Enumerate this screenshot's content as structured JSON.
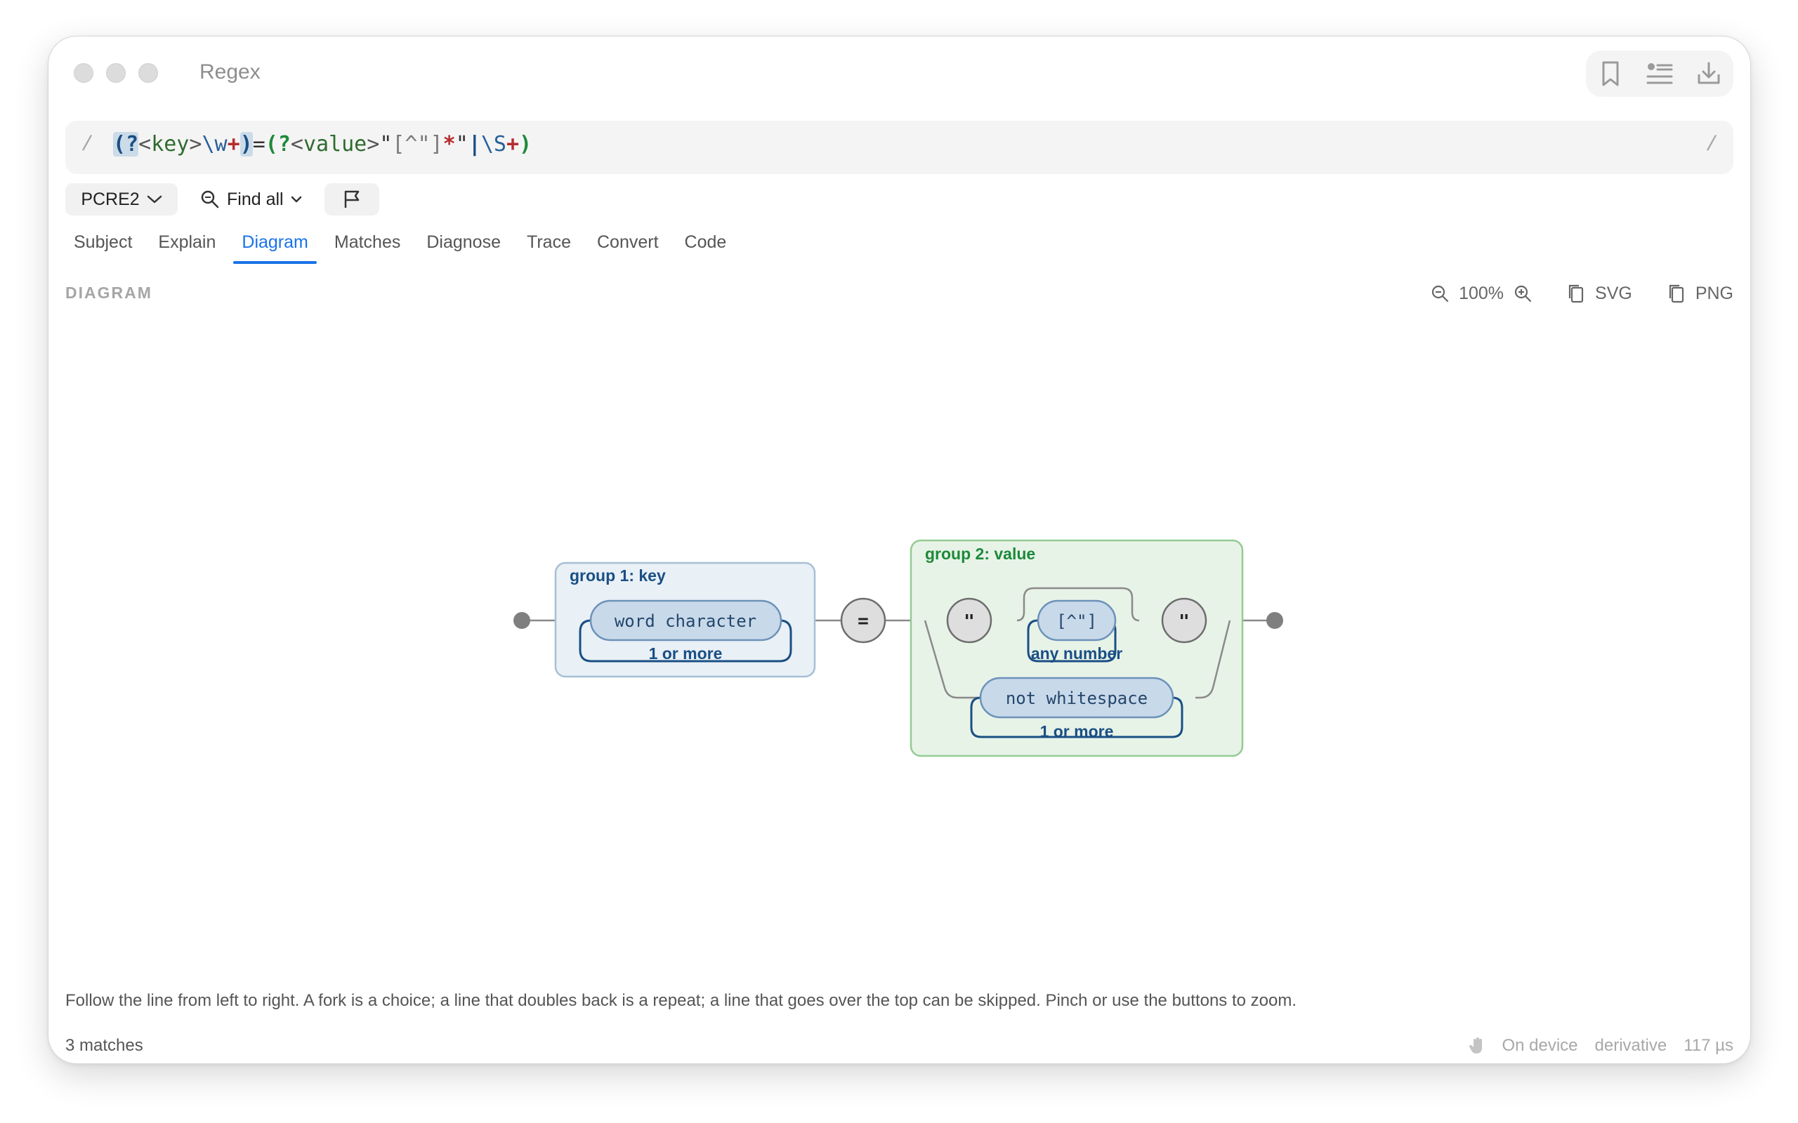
{
  "window": {
    "title": "Regex"
  },
  "regex": {
    "open_slash": "/",
    "close_slash": "/",
    "tokens": {
      "g1_open": "(?",
      "g1_name_open": "<",
      "g1_name": "key",
      "g1_name_close": ">",
      "g1_body": "\\w",
      "g1_quant": "+",
      "g1_close": ")",
      "eq": "=",
      "g2_open": "(?",
      "g2_name_open": "<",
      "g2_name": "value",
      "g2_name_close": ">",
      "q1": "\"",
      "cls": "[^\"]",
      "star": "*",
      "q2": "\"",
      "alt": "|",
      "esc": "\\S",
      "plus2": "+",
      "g2_close": ")"
    }
  },
  "toolbar": {
    "flavor": "PCRE2",
    "mode": "Find all"
  },
  "tabs": [
    "Subject",
    "Explain",
    "Diagram",
    "Matches",
    "Diagnose",
    "Trace",
    "Convert",
    "Code"
  ],
  "active_tab": "Diagram",
  "section": {
    "label": "DIAGRAM"
  },
  "zoom": {
    "level": "100%",
    "svg_label": "SVG",
    "png_label": "PNG"
  },
  "diagram": {
    "group1": {
      "label": "group 1: key",
      "node": "word character",
      "repeat": "1 or more"
    },
    "literal_eq": "=",
    "group2": {
      "label": "group 2: value",
      "quote_open": "\"",
      "class_node": "[^\"]",
      "class_repeat": "any number",
      "quote_close": "\"",
      "alt_node": "not whitespace",
      "alt_repeat": "1 or more"
    }
  },
  "hint": "Follow the line from left to right. A fork is a choice; a line that doubles back is a repeat; a line that goes over the top can be skipped. Pinch or use the buttons to zoom.",
  "status": {
    "matches": "3 matches",
    "device": "On device",
    "variant": "derivative",
    "time": "117 µs"
  },
  "colors": {
    "accent": "#1a73e8",
    "group1": "#1a4f84",
    "group2": "#1d8a3a"
  }
}
